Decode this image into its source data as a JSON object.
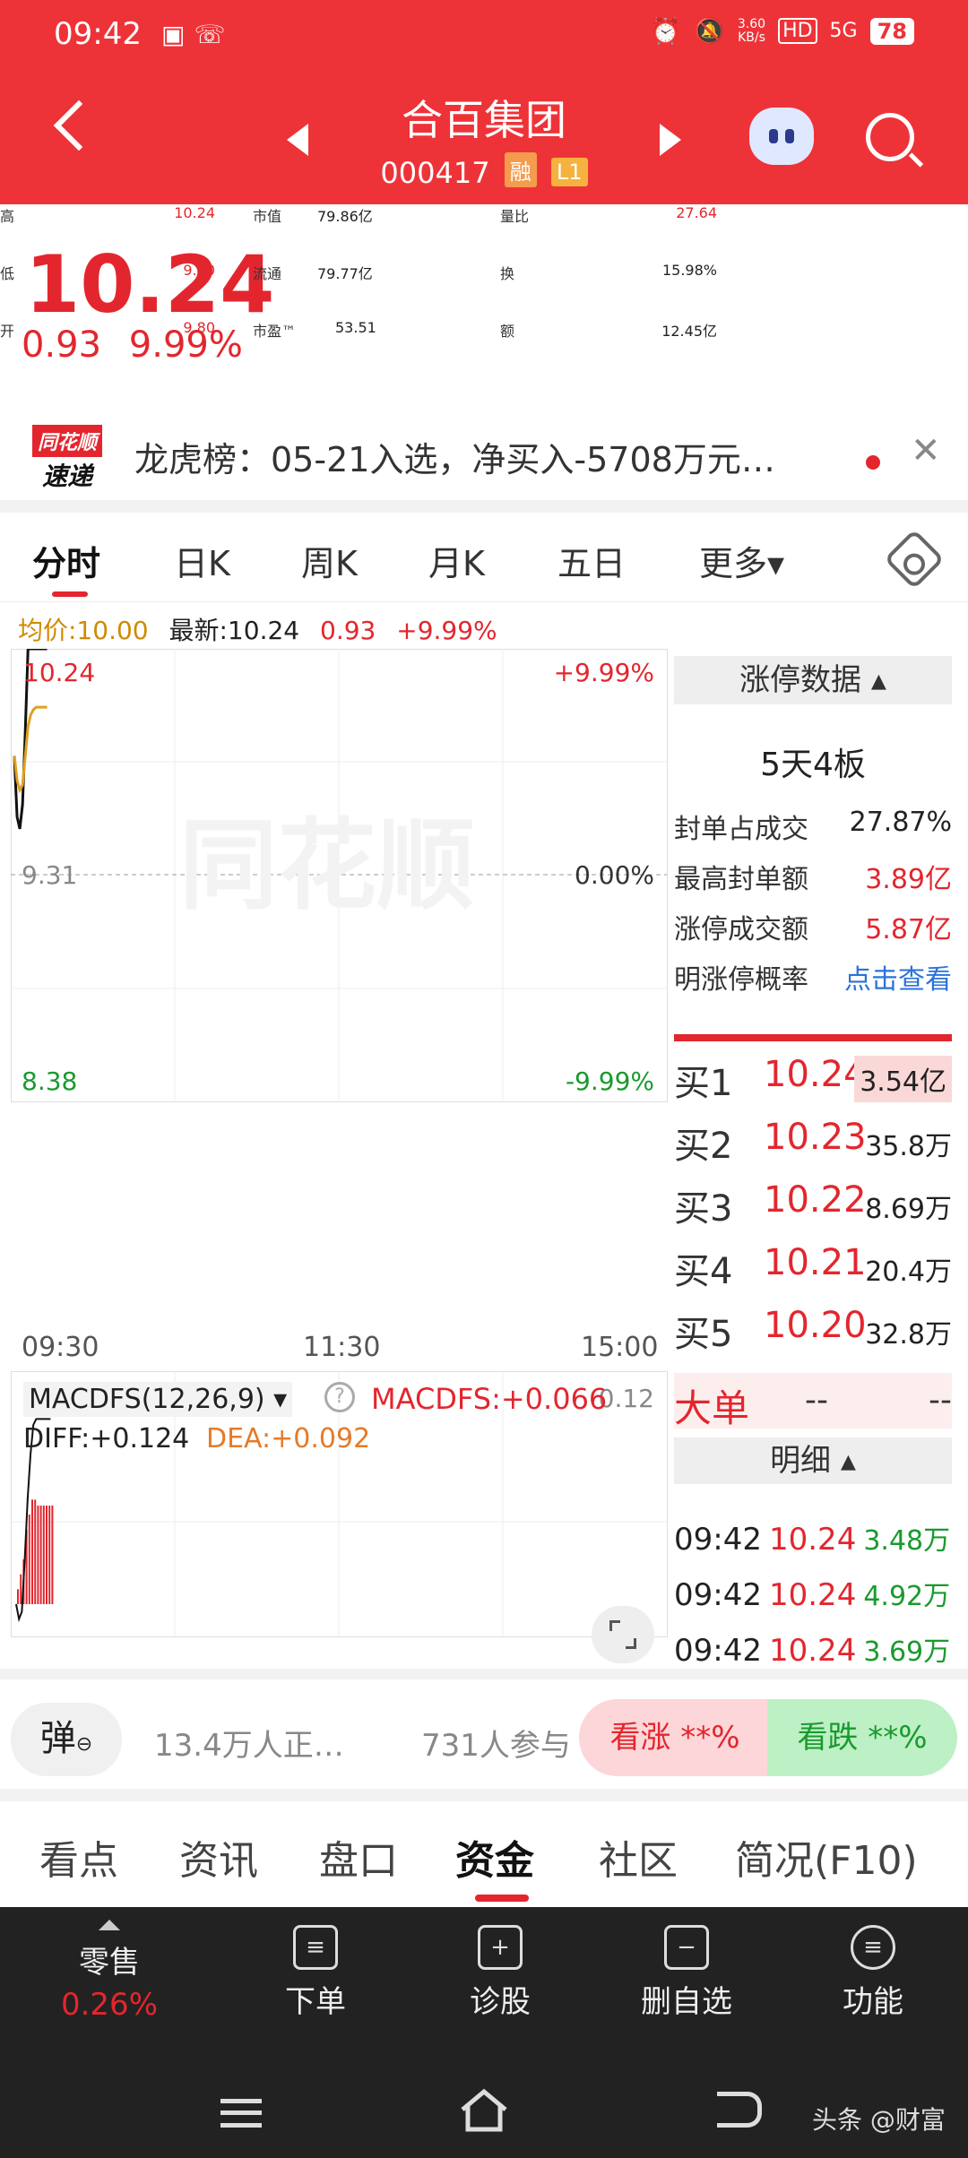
{
  "status_bar": {
    "time": "09:42",
    "net_speed_value": "3.60",
    "net_speed_unit": "KB/s",
    "hd": "HD",
    "signal": "5G",
    "battery": "78"
  },
  "header": {
    "stock_name": "合百集团",
    "stock_code": "000417",
    "tag_rong": "融",
    "tag_level": "L1"
  },
  "quote": {
    "price": "10.24",
    "change": "0.93",
    "change_pct": "9.99%",
    "rows": [
      {
        "l1": "高",
        "v1": "10.24",
        "l2": "市值",
        "v2": "79.86亿",
        "l3": "量比",
        "v3": "27.64"
      },
      {
        "l1": "低",
        "v1": "9.50",
        "l2": "流通",
        "v2": "79.77亿",
        "l3": "换",
        "v3": "15.98%"
      },
      {
        "l1": "开",
        "v1": "9.80",
        "l2": "市盈™",
        "v2": "53.51",
        "l3": "额",
        "v3": "12.45亿"
      }
    ]
  },
  "news": {
    "logo_top": "同花顺",
    "logo_bottom": "速递",
    "text": "龙虎榜：05-21入选，净买入-5708万元…",
    "close": "✕"
  },
  "chart_tabs": [
    {
      "label": "分时"
    },
    {
      "label": "日K"
    },
    {
      "label": "周K"
    },
    {
      "label": "月K"
    },
    {
      "label": "五日"
    },
    {
      "label": "更多▾"
    }
  ],
  "legend": {
    "avg": "均价:10.00",
    "latest": "最新:10.24",
    "change": "0.93",
    "change_pct": "+9.99%"
  },
  "chart_data": {
    "type": "line",
    "x_ticks": [
      "09:30",
      "11:30",
      "15:00"
    ],
    "y_left_labels": {
      "top": "10.24",
      "mid": "9.31",
      "bottom": "8.38"
    },
    "y_right_labels": {
      "top": "+9.99%",
      "mid": "0.00%",
      "bottom": "-9.99%"
    },
    "ylim": [
      8.38,
      10.24
    ],
    "prev_close": 9.31,
    "series": [
      {
        "x": [
          0,
          1,
          2,
          3,
          4,
          5,
          6,
          7,
          8,
          9,
          10,
          11,
          12
        ],
        "values": [
          9.8,
          9.55,
          9.5,
          9.6,
          9.9,
          10.24,
          10.24,
          10.24,
          10.24,
          10.24,
          10.24,
          10.24,
          10.24
        ],
        "color": "#111111"
      },
      {
        "x": [
          0,
          1,
          2,
          3,
          4,
          5,
          6,
          7,
          8,
          9,
          10,
          11,
          12
        ],
        "values": [
          9.8,
          9.7,
          9.66,
          9.68,
          9.8,
          9.92,
          9.97,
          9.99,
          10.0,
          10.0,
          10.0,
          10.0,
          10.0
        ],
        "color": "#e0a020"
      }
    ],
    "x_total": 240
  },
  "macd": {
    "title": "MACDFS(12,26,9)",
    "macdfs": "MACDFS:+0.066",
    "diff": "DIFF:+0.124",
    "dea": "DEA:+0.092",
    "right_label": "0.12",
    "bars": [
      0.01,
      0.02,
      0.03,
      0.05,
      0.06,
      0.07,
      0.07,
      0.066,
      0.066,
      0.066,
      0.066,
      0.066,
      0.066
    ],
    "diff_series": [
      0.0,
      -0.01,
      -0.005,
      0.03,
      0.07,
      0.1,
      0.12,
      0.124,
      0.124,
      0.124,
      0.124,
      0.124,
      0.124
    ],
    "max": 0.12
  },
  "limit_panel": {
    "header": "涨停数据 ▴",
    "streak": "5天4板",
    "rows": [
      {
        "label": "封单占成交",
        "value": "27.87%"
      },
      {
        "label": "最高封单额",
        "value": "3.89亿"
      },
      {
        "label": "涨停成交额",
        "value": "5.87亿"
      },
      {
        "label": "明涨停概率",
        "value": "点击查看"
      }
    ]
  },
  "order_book": [
    {
      "label": "买1",
      "price": "10.24",
      "vol": "3.54亿"
    },
    {
      "label": "买2",
      "price": "10.23",
      "vol": "35.8万"
    },
    {
      "label": "买3",
      "price": "10.22",
      "vol": "8.69万"
    },
    {
      "label": "买4",
      "price": "10.21",
      "vol": "20.4万"
    },
    {
      "label": "买5",
      "price": "10.20",
      "vol": "32.8万"
    }
  ],
  "big_order": {
    "label": "大单",
    "v1": "-- ",
    "v2": "--"
  },
  "detail": {
    "header": "明细 ▴",
    "rows": [
      {
        "time": "09:42",
        "price": "10.24",
        "vol": "3.48万"
      },
      {
        "time": "09:42",
        "price": "10.24",
        "vol": "4.92万"
      },
      {
        "time": "09:42",
        "price": "10.24",
        "vol": "3.69万"
      }
    ]
  },
  "action_bar": {
    "danmu": "弹",
    "viewers": "13.4万人正…",
    "participants": "731人参与",
    "vote_up": "看涨 **%",
    "vote_down": "看跌 **%"
  },
  "section_tabs": [
    {
      "label": "看点"
    },
    {
      "label": "资讯"
    },
    {
      "label": "盘口"
    },
    {
      "label": "资金"
    },
    {
      "label": "社区"
    },
    {
      "label": "简况(F10)"
    }
  ],
  "bottom_nav": {
    "retail_label": "零售",
    "retail_value": "0.26%",
    "items": [
      {
        "label": "下单",
        "icon": "≡"
      },
      {
        "label": "诊股",
        "icon": "+"
      },
      {
        "label": "删自选",
        "icon": "−"
      },
      {
        "label": "功能",
        "icon": "≡"
      }
    ]
  },
  "watermark": "头条 @财富",
  "colors": {
    "brand_red": "#ee3338",
    "up_red": "#e3262e",
    "down_green": "#1a9a2e"
  }
}
